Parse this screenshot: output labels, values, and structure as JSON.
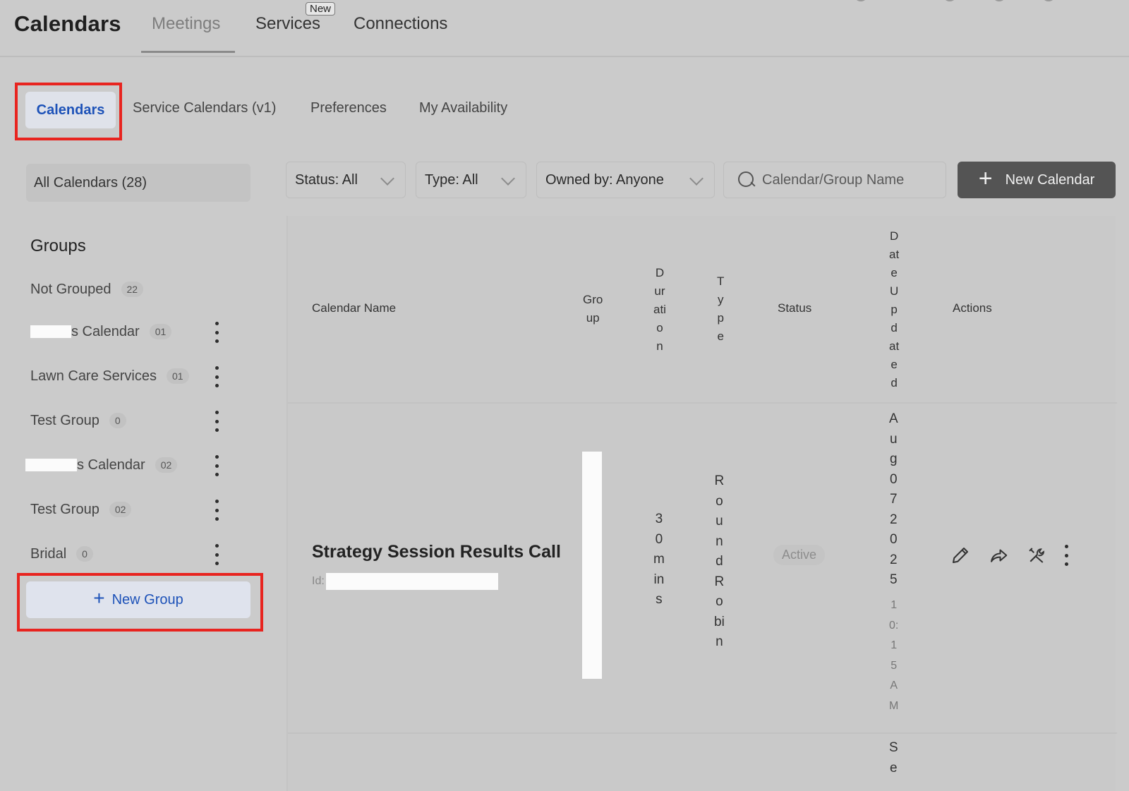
{
  "header": {
    "title": "Calendars",
    "tabs": {
      "meetings": "Meetings",
      "services": "Services",
      "services_badge": "New",
      "connections": "Connections"
    }
  },
  "subtabs": {
    "calendars": "Calendars",
    "service_calendars": "Service Calendars (v1)",
    "preferences": "Preferences",
    "my_availability": "My Availability"
  },
  "sidebar": {
    "all_calendars": "All Calendars (28)",
    "groups_title": "Groups",
    "groups": [
      {
        "label": "Not Grouped",
        "count": "22"
      },
      {
        "label": "s Calendar",
        "count": "01"
      },
      {
        "label": "Lawn Care Services",
        "count": "01"
      },
      {
        "label": "Test Group",
        "count": "0"
      },
      {
        "label": "s Calendar",
        "count": "02"
      },
      {
        "label": "Test Group",
        "count": "02"
      },
      {
        "label": "Bridal",
        "count": "0"
      }
    ],
    "new_group": "New Group"
  },
  "filters": {
    "status": "Status: All",
    "type": "Type: All",
    "owned_by": "Owned by: Anyone",
    "search_placeholder": "Calendar/Group Name",
    "new_calendar": "New Calendar"
  },
  "table": {
    "headers": {
      "calendar_name": "Calendar Name",
      "group": "Gro\nup",
      "duration": "D\nur\nati\no\nn",
      "type": "T\ny\np\ne",
      "status": "Status",
      "date_updated": "D\nat\ne\nU\np\nd\nat\ne\nd",
      "actions": "Actions"
    },
    "rows": [
      {
        "name": "Strategy Session Results Call",
        "id_label": "Id:",
        "duration": "3\n0\nm\nin\ns",
        "type": "R\no\nu\nn\nd\nR\no\nbi\nn",
        "status": "Active",
        "date": "A\nu\ng\n0\n7\n2\n0\n2\n5",
        "time": "1\n0:\n1\n5\nA\nM"
      }
    ],
    "next_row_date_partial": "S\ne"
  },
  "colors": {
    "accent_blue": "#1d52b8",
    "highlight_red": "#e8241f",
    "button_dark": "#545454"
  }
}
